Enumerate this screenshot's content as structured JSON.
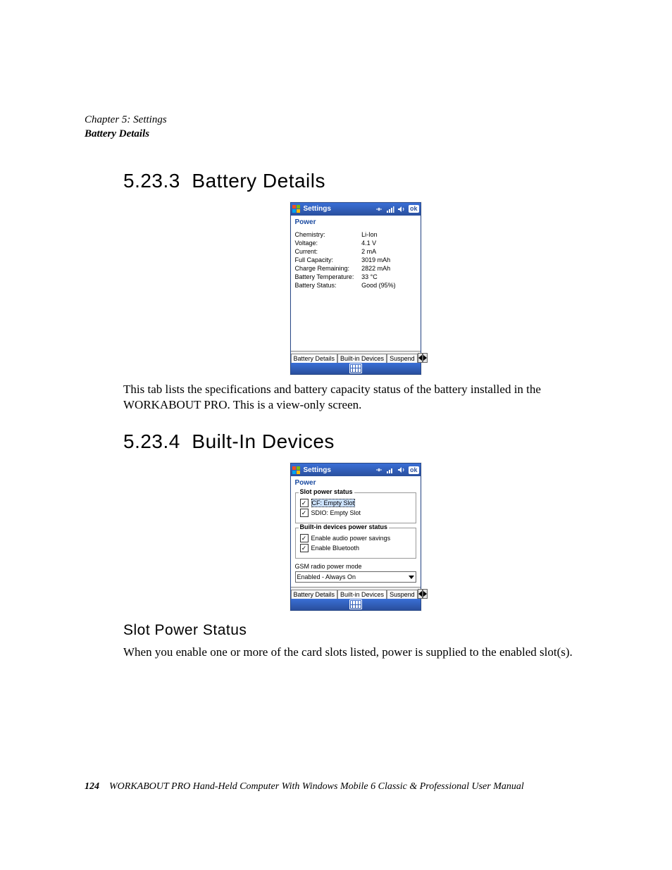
{
  "running_head": {
    "chapter": "Chapter 5: Settings",
    "section": "Battery Details"
  },
  "sections": {
    "battery_details": {
      "number": "5.23.3",
      "title": "Battery Details",
      "paragraph": "This tab lists the specifications and battery capacity status of the battery installed in the WORKABOUT PRO. This is a view-only screen."
    },
    "built_in_devices": {
      "number": "5.23.4",
      "title": "Built-In Devices"
    },
    "slot_power_status": {
      "title": "Slot Power Status",
      "paragraph": "When you enable one or more of the card slots listed, power is supplied to the enabled slot(s)."
    }
  },
  "screenshot1": {
    "titlebar": {
      "title": "Settings",
      "ok": "ok"
    },
    "subhead": "Power",
    "rows": [
      {
        "k": "Chemistry:",
        "v": "Li-Ion"
      },
      {
        "k": "Voltage:",
        "v": "4.1 V"
      },
      {
        "k": "Current:",
        "v": "2 mA"
      },
      {
        "k": "Full Capacity:",
        "v": "3019 mAh"
      },
      {
        "k": "Charge Remaining:",
        "v": "2822 mAh"
      },
      {
        "k": "Battery Temperature:",
        "v": "33 °C"
      },
      {
        "k": "Battery Status:",
        "v": "Good (95%)"
      }
    ],
    "tabs": {
      "t1": "Battery Details",
      "t2": "Built-in Devices",
      "t3": "Suspend"
    }
  },
  "screenshot2": {
    "titlebar": {
      "title": "Settings",
      "ok": "ok"
    },
    "subhead": "Power",
    "group_slot": {
      "legend": "Slot power status",
      "cf": "CF: Empty Slot",
      "sdio": "SDIO: Empty Slot"
    },
    "group_builtin": {
      "legend": "Built-in devices power status",
      "audio": "Enable audio power savings",
      "bt": "Enable Bluetooth"
    },
    "gsm_label": "GSM radio power mode",
    "gsm_value": "Enabled - Always On",
    "tabs": {
      "t1": "Battery Details",
      "t2": "Built-in Devices",
      "t3": "Suspend"
    }
  },
  "footer": {
    "page": "124",
    "text": "WORKABOUT PRO Hand-Held Computer With Windows Mobile 6 Classic & Professional User Manual"
  }
}
